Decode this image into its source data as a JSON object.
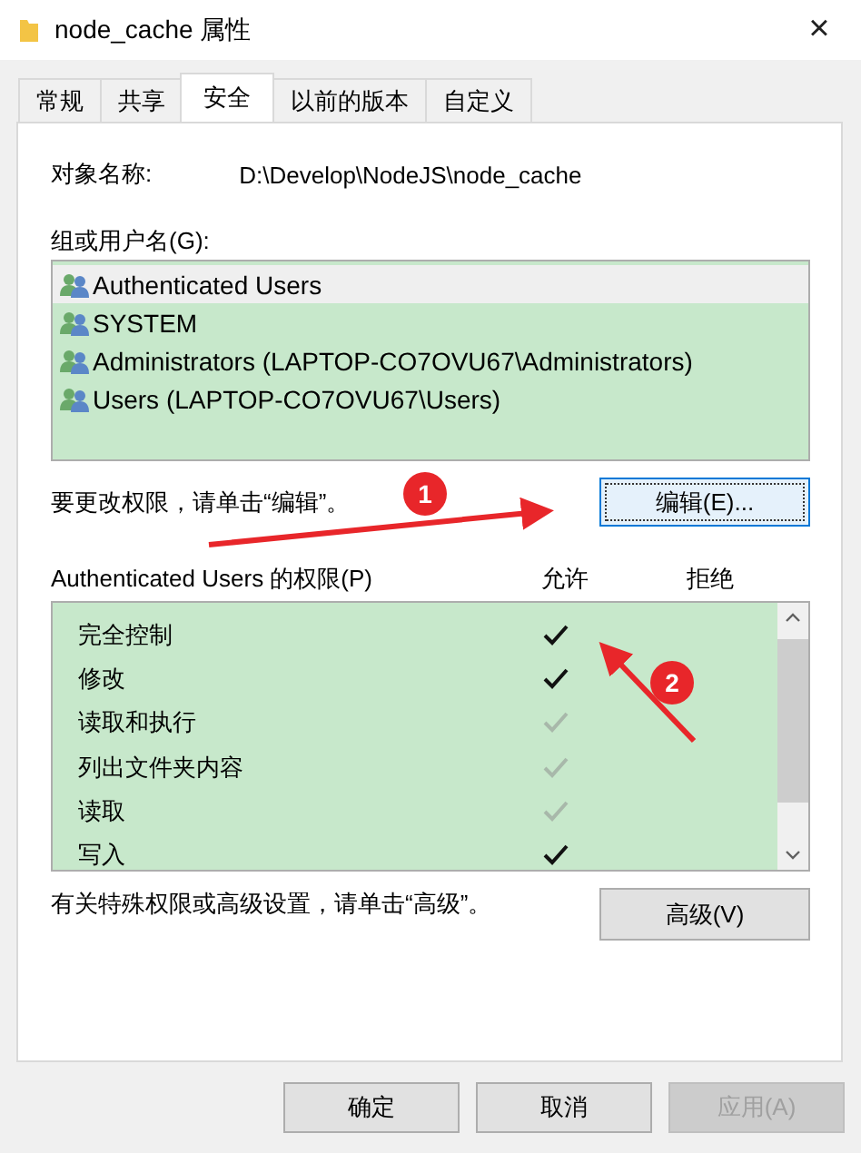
{
  "window": {
    "title": "node_cache 属性",
    "close": "×"
  },
  "tabs": [
    {
      "label": "常规",
      "selected": false
    },
    {
      "label": "共享",
      "selected": false
    },
    {
      "label": "安全",
      "selected": true
    },
    {
      "label": "以前的版本",
      "selected": false
    },
    {
      "label": "自定义",
      "selected": false
    }
  ],
  "object_name": {
    "label": "对象名称:",
    "value": "D:\\Develop\\NodeJS\\node_cache"
  },
  "groups": {
    "label": "组或用户名(G):",
    "items": [
      {
        "name": "Authenticated Users",
        "selected": true
      },
      {
        "name": "SYSTEM",
        "selected": false
      },
      {
        "name": "Administrators (LAPTOP-CO7OVU67\\Administrators)",
        "selected": false
      },
      {
        "name": "Users (LAPTOP-CO7OVU67\\Users)",
        "selected": false
      }
    ]
  },
  "edit_hint": "要更改权限，请单击“编辑”。",
  "edit_button": "编辑(E)...",
  "permissions": {
    "label": "Authenticated Users 的权限(P)",
    "allow_header": "允许",
    "deny_header": "拒绝",
    "items": [
      {
        "name": "完全控制",
        "allow": true,
        "inherited": false
      },
      {
        "name": "修改",
        "allow": true,
        "inherited": false
      },
      {
        "name": "读取和执行",
        "allow": true,
        "inherited": true
      },
      {
        "name": "列出文件夹内容",
        "allow": true,
        "inherited": true
      },
      {
        "name": "读取",
        "allow": true,
        "inherited": true
      },
      {
        "name": "写入",
        "allow": true,
        "inherited": false
      }
    ]
  },
  "advanced_hint": "有关特殊权限或高级设置，请单击“高级”。",
  "advanced_button": "高级(V)",
  "buttons": [
    {
      "label": "确定",
      "disabled": false
    },
    {
      "label": "取消",
      "disabled": false
    },
    {
      "label": "应用(A)",
      "disabled": true
    }
  ],
  "annotations": [
    {
      "label": "1"
    },
    {
      "label": "2"
    }
  ]
}
